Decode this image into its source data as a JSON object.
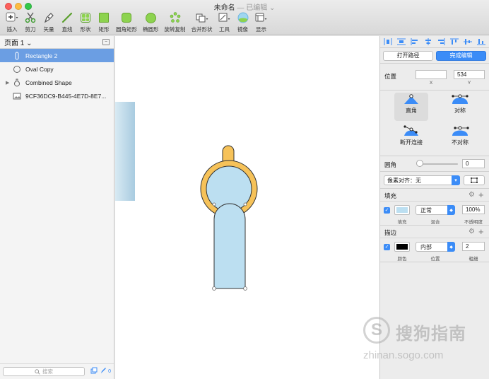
{
  "window": {
    "title": "未命名",
    "subtitle": "— 已编辑 ⌄"
  },
  "toolbar": {
    "tools": [
      {
        "id": "insert",
        "label": "插入",
        "icon": "plus-icon"
      },
      {
        "id": "scissors",
        "label": "剪刀",
        "icon": "scissors-icon"
      },
      {
        "id": "vector",
        "label": "矢量",
        "icon": "pen-icon"
      },
      {
        "id": "line",
        "label": "直线",
        "icon": "line-icon"
      },
      {
        "id": "shape",
        "label": "形状",
        "icon": "shapes-grid-icon"
      },
      {
        "id": "rect",
        "label": "矩形",
        "icon": "rectangle-icon"
      },
      {
        "id": "rounded",
        "label": "圆角矩形",
        "icon": "rounded-rectangle-icon"
      },
      {
        "id": "oval",
        "label": "椭圆形",
        "icon": "oval-icon"
      },
      {
        "id": "rotate-copy",
        "label": "旋转复制",
        "icon": "rotate-copy-icon"
      },
      {
        "id": "combine",
        "label": "合并形状",
        "icon": "combine-shapes-icon"
      },
      {
        "id": "tools",
        "label": "工具",
        "icon": "tools-icon"
      },
      {
        "id": "mirror",
        "label": "镜像",
        "icon": "mirror-icon"
      },
      {
        "id": "view",
        "label": "显示",
        "icon": "view-icon"
      }
    ]
  },
  "sidebar": {
    "page_label": "页面 1 ⌄",
    "layers": [
      {
        "name": "Rectangle 2",
        "type": "rectangle",
        "selected": true
      },
      {
        "name": "Oval Copy",
        "type": "oval",
        "selected": false
      },
      {
        "name": "Combined Shape",
        "type": "combined",
        "selected": false
      },
      {
        "name": "9CF36DC9-B445-4E7D-8E7...",
        "type": "image",
        "selected": false
      }
    ],
    "search_placeholder": "搜索",
    "footer_count": "0"
  },
  "inspector": {
    "open_path": "打开路径",
    "finish_edit": "完成编辑",
    "position": {
      "label": "位置",
      "x": "",
      "y": "534",
      "x_label": "X",
      "y_label": "Y"
    },
    "point_types": [
      {
        "label": "直角",
        "active": true
      },
      {
        "label": "对称",
        "active": false
      },
      {
        "label": "断开连接",
        "active": false
      },
      {
        "label": "不对称",
        "active": false
      }
    ],
    "corner": {
      "label": "圆角",
      "value": "0"
    },
    "pixel_align": "像素对齐：无",
    "fill": {
      "title": "填充",
      "color": "#bcdff1",
      "blend": "正常",
      "opacity": "100%",
      "col_fill": "填充",
      "col_blend": "混合",
      "col_opacity": "不透明度"
    },
    "border": {
      "title": "描边",
      "color": "#000000",
      "position": "内部",
      "width": "2",
      "col_color": "颜色",
      "col_position": "位置",
      "col_width": "粗细"
    }
  },
  "colors": {
    "accent": "#3b8cf7",
    "selection": "#6b9ee3",
    "shape_fill": "#bcdff1",
    "ring_fill": "#f6c259"
  },
  "watermark": {
    "brand": "搜狗指南",
    "logo_letter": "S",
    "url": "zhinan.sogo.com"
  }
}
